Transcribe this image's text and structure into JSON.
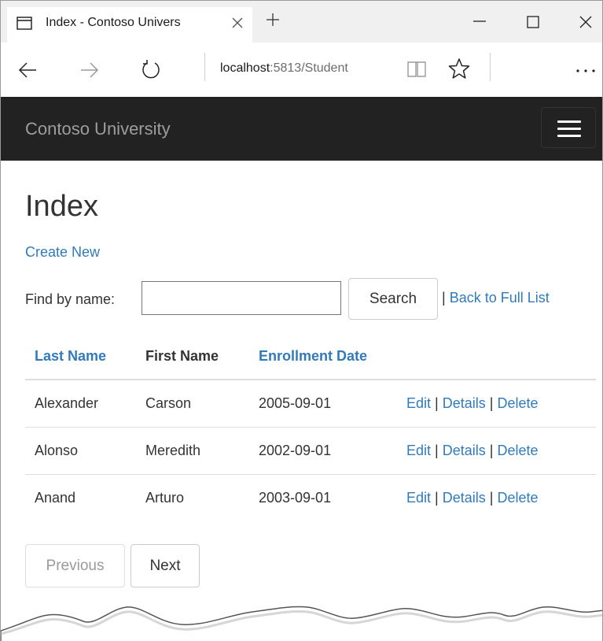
{
  "browser": {
    "tab_title": "Index - Contoso Univers",
    "url_host": "localhost",
    "url_path": ":5813/Student"
  },
  "site": {
    "brand": "Contoso University"
  },
  "page": {
    "title": "Index",
    "create_link": "Create New",
    "find_label": "Find by name:",
    "search_value": "",
    "search_button": "Search",
    "separator": "|",
    "back_link": "Back to Full List"
  },
  "table": {
    "headers": {
      "last_name": "Last Name",
      "first_name": "First Name",
      "enrollment_date": "Enrollment Date"
    },
    "rows": [
      {
        "last": "Alexander",
        "first": "Carson",
        "date": "2005-09-01"
      },
      {
        "last": "Alonso",
        "first": "Meredith",
        "date": "2002-09-01"
      },
      {
        "last": "Anand",
        "first": "Arturo",
        "date": "2003-09-01"
      }
    ],
    "actions": {
      "edit": "Edit",
      "details": "Details",
      "delete": "Delete",
      "sep": "|"
    }
  },
  "pager": {
    "previous": "Previous",
    "next": "Next"
  },
  "colors": {
    "link": "#337ab7",
    "navbar_bg": "#222222",
    "brand_text": "#9d9d9d"
  }
}
